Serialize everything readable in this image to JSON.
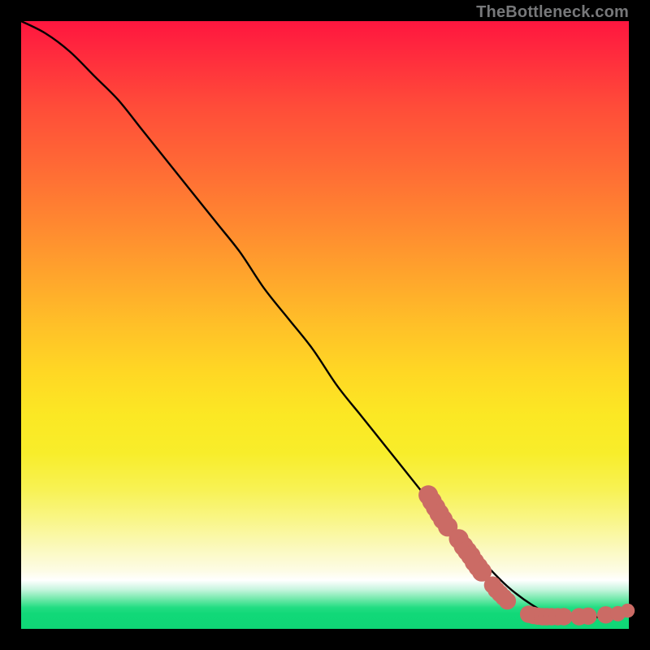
{
  "watermark": "TheBottleneck.com",
  "chart_data": {
    "type": "line",
    "title": "",
    "xlabel": "",
    "ylabel": "",
    "xlim": [
      0,
      100
    ],
    "ylim": [
      0,
      100
    ],
    "grid": false,
    "legend": false,
    "series": [
      {
        "name": "bottleneck-curve",
        "color": "#000000",
        "x": [
          0,
          4,
          8,
          12,
          16,
          20,
          24,
          28,
          32,
          36,
          40,
          44,
          48,
          52,
          56,
          60,
          64,
          68,
          72,
          76,
          80,
          84,
          88,
          92,
          96,
          100
        ],
        "y": [
          100,
          98,
          95,
          91,
          87,
          82,
          77,
          72,
          67,
          62,
          56,
          51,
          46,
          40,
          35,
          30,
          25,
          20,
          15,
          11,
          7,
          4,
          2,
          2,
          2,
          3
        ]
      }
    ],
    "marker_points": {
      "name": "highlight-dots",
      "color": "#cb6b65",
      "points": [
        {
          "x": 67.0,
          "y": 22.0,
          "r": 1.2
        },
        {
          "x": 67.6,
          "y": 21.0,
          "r": 1.2
        },
        {
          "x": 68.2,
          "y": 20.0,
          "r": 1.2
        },
        {
          "x": 68.8,
          "y": 19.0,
          "r": 1.2
        },
        {
          "x": 69.4,
          "y": 18.0,
          "r": 1.2
        },
        {
          "x": 70.2,
          "y": 16.8,
          "r": 1.2
        },
        {
          "x": 72.0,
          "y": 14.8,
          "r": 1.2
        },
        {
          "x": 72.8,
          "y": 13.6,
          "r": 1.2
        },
        {
          "x": 73.4,
          "y": 12.8,
          "r": 1.2
        },
        {
          "x": 74.0,
          "y": 12.0,
          "r": 1.2
        },
        {
          "x": 74.6,
          "y": 11.0,
          "r": 1.2
        },
        {
          "x": 75.2,
          "y": 10.2,
          "r": 1.2
        },
        {
          "x": 75.8,
          "y": 9.4,
          "r": 1.2
        },
        {
          "x": 77.6,
          "y": 7.2,
          "r": 1.0
        },
        {
          "x": 78.2,
          "y": 6.4,
          "r": 1.0
        },
        {
          "x": 78.8,
          "y": 5.8,
          "r": 1.0
        },
        {
          "x": 79.4,
          "y": 5.2,
          "r": 1.0
        },
        {
          "x": 80.0,
          "y": 4.6,
          "r": 1.0
        },
        {
          "x": 83.5,
          "y": 2.4,
          "r": 1.0
        },
        {
          "x": 84.3,
          "y": 2.2,
          "r": 1.0
        },
        {
          "x": 85.0,
          "y": 2.1,
          "r": 1.0
        },
        {
          "x": 85.8,
          "y": 2.0,
          "r": 1.0
        },
        {
          "x": 86.5,
          "y": 2.0,
          "r": 1.0
        },
        {
          "x": 87.3,
          "y": 2.0,
          "r": 1.0
        },
        {
          "x": 88.3,
          "y": 2.0,
          "r": 1.0
        },
        {
          "x": 89.3,
          "y": 2.0,
          "r": 1.0
        },
        {
          "x": 91.8,
          "y": 2.0,
          "r": 1.0
        },
        {
          "x": 93.3,
          "y": 2.1,
          "r": 1.0
        },
        {
          "x": 96.2,
          "y": 2.3,
          "r": 1.0
        },
        {
          "x": 98.2,
          "y": 2.5,
          "r": 0.8
        },
        {
          "x": 99.8,
          "y": 3.0,
          "r": 0.7
        }
      ]
    },
    "gradient_stops": [
      {
        "pos": 0.0,
        "color": "#ff163f"
      },
      {
        "pos": 0.5,
        "color": "#ffc028"
      },
      {
        "pos": 0.77,
        "color": "#f8f253"
      },
      {
        "pos": 0.92,
        "color": "#ffffff"
      },
      {
        "pos": 1.0,
        "color": "#0fd676"
      }
    ]
  }
}
